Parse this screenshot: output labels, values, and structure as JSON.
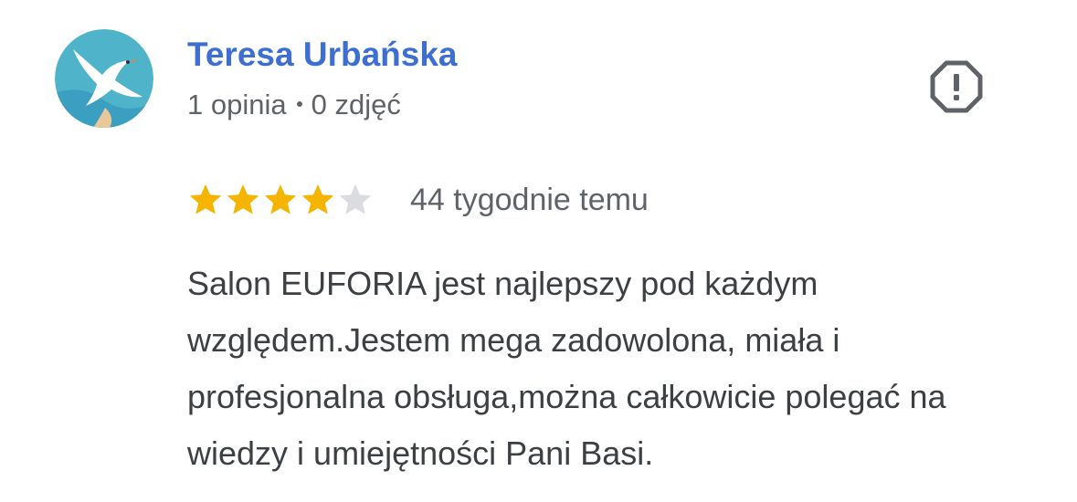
{
  "author": {
    "name": "Teresa Urbańska",
    "reviews_count": "1 opinia",
    "photos_count": "0 zdjęć",
    "avatar_icon": "seagull-avatar-icon"
  },
  "report": {
    "icon": "report-icon"
  },
  "review": {
    "rating": 4,
    "max_rating": 5,
    "date": "44 tygodnie temu",
    "text": "Salon EUFORIA jest najlepszy pod każdym względem.Jestem mega zadowolona, miała i profesjonalna obsługa,można całkowicie polegać na wiedzy i umiejętności Pani Basi."
  },
  "colors": {
    "name_link": "#3c6fd1",
    "meta_text": "#5f6368",
    "body_text": "#3c4043",
    "star_filled": "#f4b400",
    "star_empty": "#dadce0",
    "report_icon": "#5f6368"
  }
}
